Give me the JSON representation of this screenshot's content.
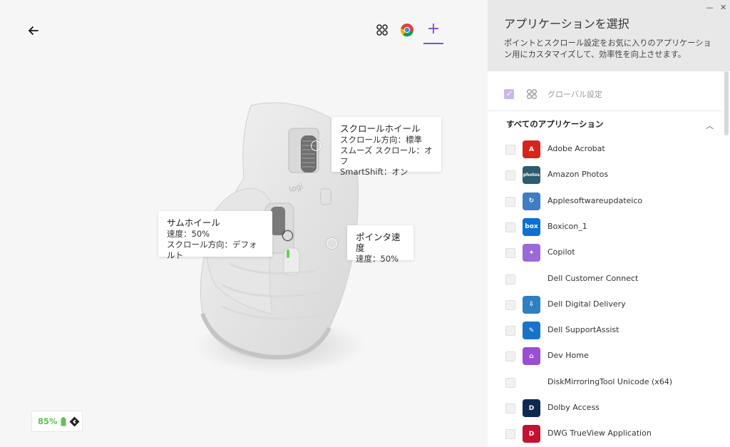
{
  "toolbar": {
    "back_icon": "back-arrow-icon",
    "apps_icon": "app-grid-icon",
    "chrome_icon": "chrome-icon",
    "add_icon": "plus-icon",
    "add_label": "+"
  },
  "callouts": {
    "scroll_wheel": {
      "title": "スクロールホイール",
      "line1": "スクロール方向：標準",
      "line2": "スムーズ スクロール：オフ",
      "line3": "SmartShift：オン"
    },
    "thumb_wheel": {
      "title": "サムホイール",
      "line1": "速度：50%",
      "line2": "スクロール方向：デフォルト"
    },
    "pointer_speed": {
      "title": "ポインタ速度",
      "line1": "速度：50%"
    }
  },
  "battery": {
    "percent": "85%",
    "icon": "battery-icon",
    "connection_icon": "logi-bolt-icon"
  },
  "panel": {
    "title": "アプリケーションを選択",
    "description": "ポイントとスクロール設定をお気に入りのアプリケーション用にカスタマイズして、効率性を向上させます。",
    "global_label": "グローバル設定",
    "global_checked": true,
    "section_title": "すべてのアプリケーション",
    "minimize": "—",
    "close": "✕",
    "apps": [
      {
        "name": "Adobe Acrobat",
        "icon": "adobe-acrobat-icon",
        "color": "#d7251b",
        "glyph": "A"
      },
      {
        "name": "Amazon Photos",
        "icon": "amazon-photos-icon",
        "color": "#2b5d6e",
        "glyph": "photos"
      },
      {
        "name": "Applesoftwareupdateico",
        "icon": "apple-update-icon",
        "color": "#3f7cc4",
        "glyph": "↻"
      },
      {
        "name": "Boxicon_1",
        "icon": "box-icon",
        "color": "#0b6fd6",
        "glyph": "box"
      },
      {
        "name": "Copilot",
        "icon": "copilot-icon",
        "color": "#9a6ad8",
        "glyph": "✦"
      },
      {
        "name": "Dell Customer Connect",
        "icon": "dell-customer-connect-icon",
        "color": "#ffffff",
        "glyph": ""
      },
      {
        "name": "Dell Digital Delivery",
        "icon": "dell-digital-delivery-icon",
        "color": "#2f7fc4",
        "glyph": "⇩"
      },
      {
        "name": "Dell SupportAssist",
        "icon": "dell-supportassist-icon",
        "color": "#1a72c9",
        "glyph": "✎"
      },
      {
        "name": "Dev Home",
        "icon": "dev-home-icon",
        "color": "#9a4fd0",
        "glyph": "⌂"
      },
      {
        "name": "DiskMirroringTool Unicode (x64)",
        "icon": "disk-mirroring-icon",
        "color": "#ffffff",
        "glyph": ""
      },
      {
        "name": "Dolby Access",
        "icon": "dolby-access-icon",
        "color": "#0d2950",
        "glyph": "D"
      },
      {
        "name": "DWG TrueView Application",
        "icon": "dwg-trueview-icon",
        "color": "#c3122f",
        "glyph": "D"
      }
    ]
  }
}
